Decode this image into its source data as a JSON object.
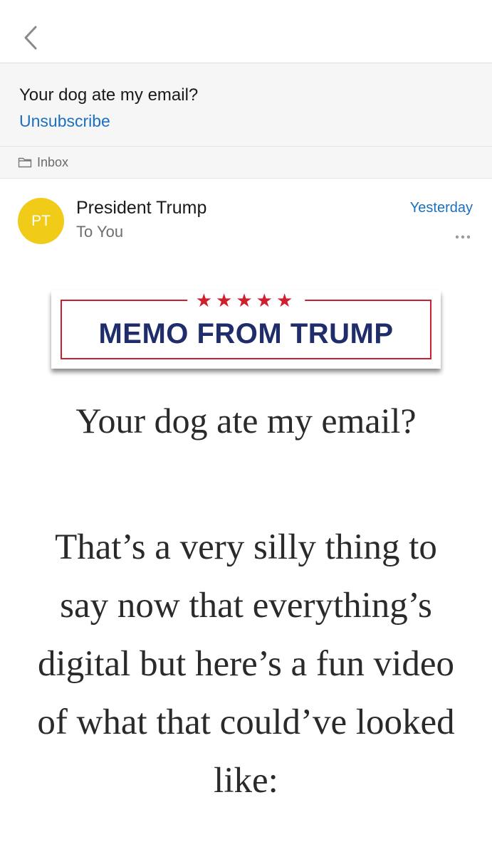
{
  "topbar": {
    "back_icon": "chevron-left-icon"
  },
  "email": {
    "subject": "Your dog ate my email?",
    "unsubscribe_label": "Unsubscribe",
    "folder": "Inbox",
    "folder_icon": "folder-icon"
  },
  "sender": {
    "initials": "PT",
    "name": "President Trump",
    "to": "To You",
    "date": "Yesterday",
    "avatar_color": "#f0cc18",
    "more_icon": "more-horizontal-icon"
  },
  "banner": {
    "stars": "★★★★★",
    "title": "MEMO FROM TRUMP"
  },
  "body": {
    "title": "Your dog ate my email?",
    "paragraph": "That’s a very silly thing to say now that everything’s digital but here’s a fun video of what that could’ve looked like:"
  },
  "colors": {
    "link": "#1b6fbf",
    "banner_red": "#c8202e",
    "banner_navy": "#1f2d6b"
  }
}
